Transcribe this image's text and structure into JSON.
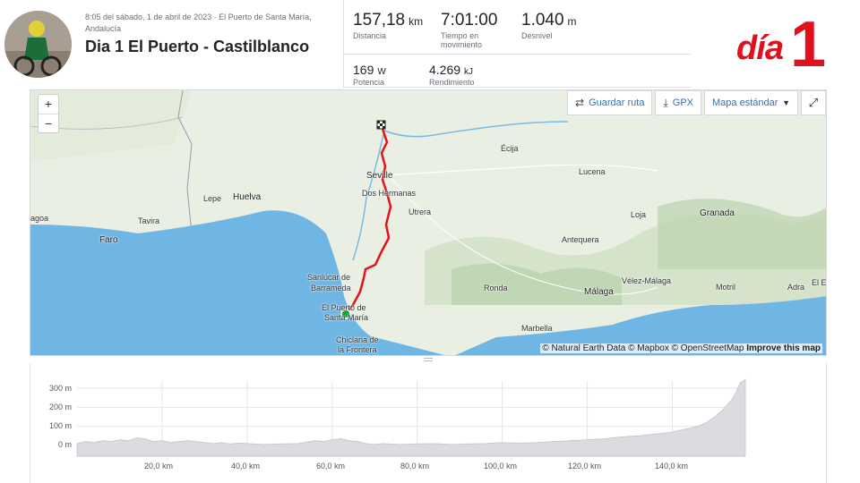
{
  "header": {
    "datetime_location": "8:05 del sábado, 1 de abril de 2023 · El Puerto de Santa María, Andalucía",
    "activity_title": "Dia 1 El Puerto - Castilblanco"
  },
  "stats": [
    {
      "value": "157,18",
      "unit": "km",
      "label": "Distancia"
    },
    {
      "value": "7:01:00",
      "unit": "",
      "label": "Tiempo en movimiento"
    },
    {
      "value": "1.040",
      "unit": "m",
      "label": "Desnivel"
    },
    {
      "value": "169",
      "unit": "W",
      "label": "Potencia"
    },
    {
      "value": "4.269",
      "unit": "kJ",
      "label": "Rendimiento"
    }
  ],
  "day_badge": {
    "word": "día",
    "number": "1"
  },
  "map": {
    "zoom_in": "+",
    "zoom_out": "−",
    "save_route": "Guardar ruta",
    "gpx": "GPX",
    "map_type": "Mapa estándar",
    "attribution_prefix": "© Natural Earth Data © Mapbox © OpenStreetMap",
    "attribution_link": "Improve this map",
    "cities": {
      "ecija": "Écija",
      "lucena": "Lucena",
      "seville": "Seville",
      "dos_hermanas": "Dos Hermanas",
      "utrera": "Utrera",
      "lepe": "Lepe",
      "huelva": "Huelva",
      "tavira": "Tavira",
      "lagoa": "agoa",
      "faro": "Faro",
      "loja": "Loja",
      "granada": "Granada",
      "antequera": "Antequera",
      "sanlucar_1": "Sanlúcar de",
      "sanlucar_2": "Barrameda",
      "ronda": "Ronda",
      "velez": "Vélez-Málaga",
      "motril": "Motril",
      "adra": "Adra",
      "elej": "El Ej",
      "malaga": "Málaga",
      "puerto_1": "El Puerto de",
      "puerto_2": "Santa María",
      "marbella": "Marbella",
      "chiclana_1": "Chiclana de",
      "chiclana_2": "la Frontera"
    },
    "colors": {
      "route": "#e0141b",
      "start": "#16a32e",
      "sea": "#6fb6e4",
      "land": "#e9efe3"
    }
  },
  "elevation": {
    "y_ticks": [
      "300 m",
      "200 m",
      "100 m",
      "0 m"
    ],
    "x_ticks": [
      "20,0 km",
      "40,0 km",
      "60,0 km",
      "80,0 km",
      "100,0 km",
      "120,0 km",
      "140,0 km"
    ],
    "chart_data": {
      "type": "area",
      "xlabel": "",
      "ylabel": "",
      "x_unit": "km",
      "y_unit": "m",
      "xlim": [
        0,
        157.18
      ],
      "ylim": [
        0,
        300
      ],
      "x": [
        0,
        2,
        4,
        6,
        8,
        10,
        12,
        14,
        16,
        18,
        20,
        22,
        24,
        26,
        28,
        30,
        32,
        34,
        36,
        38,
        40,
        44,
        48,
        52,
        56,
        58,
        60,
        62,
        64,
        66,
        68,
        70,
        72,
        76,
        80,
        84,
        88,
        92,
        96,
        100,
        104,
        108,
        112,
        116,
        120,
        124,
        128,
        132,
        136,
        140,
        142,
        144,
        146,
        148,
        150,
        152,
        154,
        155,
        156,
        157.18
      ],
      "y": [
        10,
        20,
        15,
        25,
        20,
        30,
        25,
        40,
        35,
        20,
        25,
        15,
        20,
        25,
        20,
        15,
        10,
        15,
        8,
        12,
        10,
        5,
        8,
        10,
        25,
        20,
        30,
        35,
        25,
        20,
        10,
        5,
        10,
        5,
        8,
        10,
        5,
        8,
        10,
        15,
        12,
        15,
        20,
        25,
        30,
        35,
        45,
        50,
        60,
        70,
        80,
        90,
        100,
        120,
        150,
        190,
        240,
        280,
        330,
        345
      ]
    }
  }
}
